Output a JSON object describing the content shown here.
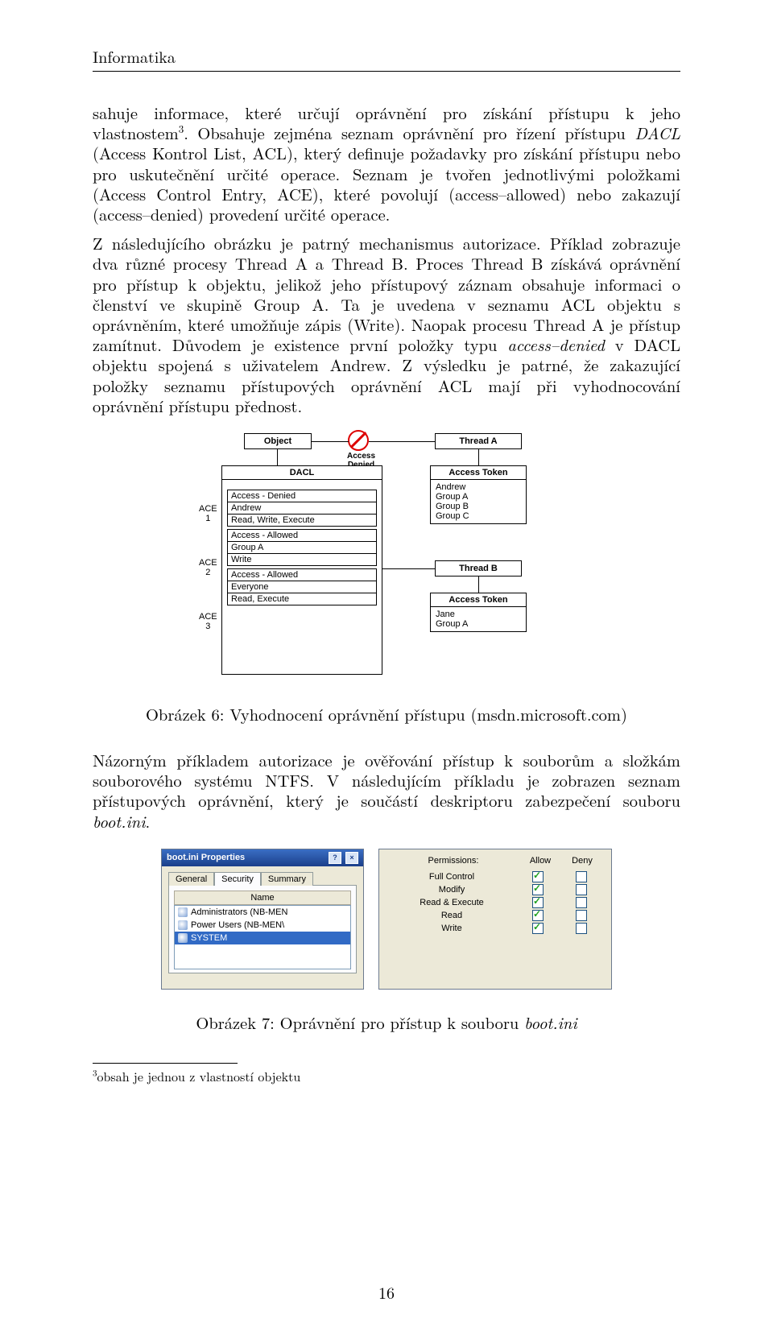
{
  "running_head": "Informatika",
  "para1_a": "sahuje informace, které určují oprávnění pro získání přístupu k jeho vlastnostem",
  "para1_fn_mark": "3",
  "para1_b": ". Obsahuje zejména seznam oprávnění pro řízení přístupu ",
  "para1_dacl": "DACL",
  "para1_c": " (Access Kontrol List, ACL), který definuje požadavky pro získání přístupu nebo pro uskutečnění určité operace. Seznam je tvořen jednotlivými položkami (Access Control Entry, ACE), které povolují (access–allowed) nebo zakazují (access–denied) provedení určité operace.",
  "para2_a": "Z následujícího obrázku je patrný mechanismus autorizace. Příklad zobrazuje dva různé procesy Thread A a Thread B. Proces Thread B získává oprávnění pro přístup k objektu, jelikož jeho přístupový záznam obsahuje informaci o členství ve skupině Group A. Ta je uvedena v seznamu ACL objektu s oprávněním, které umožňuje zápis (Write). Naopak procesu Thread A je přístup zamítnut. Důvodem je existence první položky typu ",
  "para2_ad": "access–denied",
  "para2_b": " v DACL objektu spojená s uživatelem Andrew. Z výsledku je patrné, že zakazující položky seznamu přístupových oprávnění ACL mají při vyhodnocování oprávnění přístupu přednost.",
  "fig6": {
    "object": "Object",
    "access_denied": "Access\nDenied",
    "dacl": "DACL",
    "ace1": "ACE\n1",
    "ace2": "ACE\n2",
    "ace3": "ACE\n3",
    "ace1_rows": [
      "Access - Denied",
      "Andrew",
      "Read, Write, Execute"
    ],
    "ace2_rows": [
      "Access - Allowed",
      "Group A",
      "Write"
    ],
    "ace3_rows": [
      "Access - Allowed",
      "Everyone",
      "Read, Execute"
    ],
    "threadA": "Thread A",
    "threadB": "Thread B",
    "tokenA_hdr": "Access Token",
    "tokenA_rows": [
      "Andrew",
      "Group A",
      "Group B",
      "Group C"
    ],
    "tokenB_hdr": "Access Token",
    "tokenB_rows": [
      "Jane",
      "Group A"
    ]
  },
  "caption6": "Obrázek 6: Vyhodnocení oprávnění přístupu (msdn.microsoft.com)",
  "para3_a": "Názorným příkladem autorizace je ověřování přístup k souborům a složkám souborového systému NTFS. V následujícím příkladu je zobrazen seznam přístupových oprávnění, který je součástí deskriptoru zabezpečení souboru ",
  "para3_boot": "boot.ini",
  "para3_b": ".",
  "fig7": {
    "title": "boot.ini Properties",
    "help": "?",
    "close": "×",
    "tabs": [
      "General",
      "Security",
      "Summary"
    ],
    "colhdr": "Name",
    "users": [
      "Administrators (NB-MEN",
      "Power Users (NB-MEN\\",
      "SYSTEM"
    ],
    "perm_label": "Permissions:",
    "allow": "Allow",
    "deny": "Deny",
    "perms": [
      {
        "name": "Full Control",
        "allow": true,
        "deny": false
      },
      {
        "name": "Modify",
        "allow": true,
        "deny": false
      },
      {
        "name": "Read & Execute",
        "allow": true,
        "deny": false
      },
      {
        "name": "Read",
        "allow": true,
        "deny": false
      },
      {
        "name": "Write",
        "allow": true,
        "deny": false
      }
    ]
  },
  "caption7_a": "Obrázek 7: Oprávnění pro přístup k souboru ",
  "caption7_b": "boot.ini",
  "footnote_mark": "3",
  "footnote_text": "obsah je jednou z vlastností objektu",
  "page_number": "16"
}
